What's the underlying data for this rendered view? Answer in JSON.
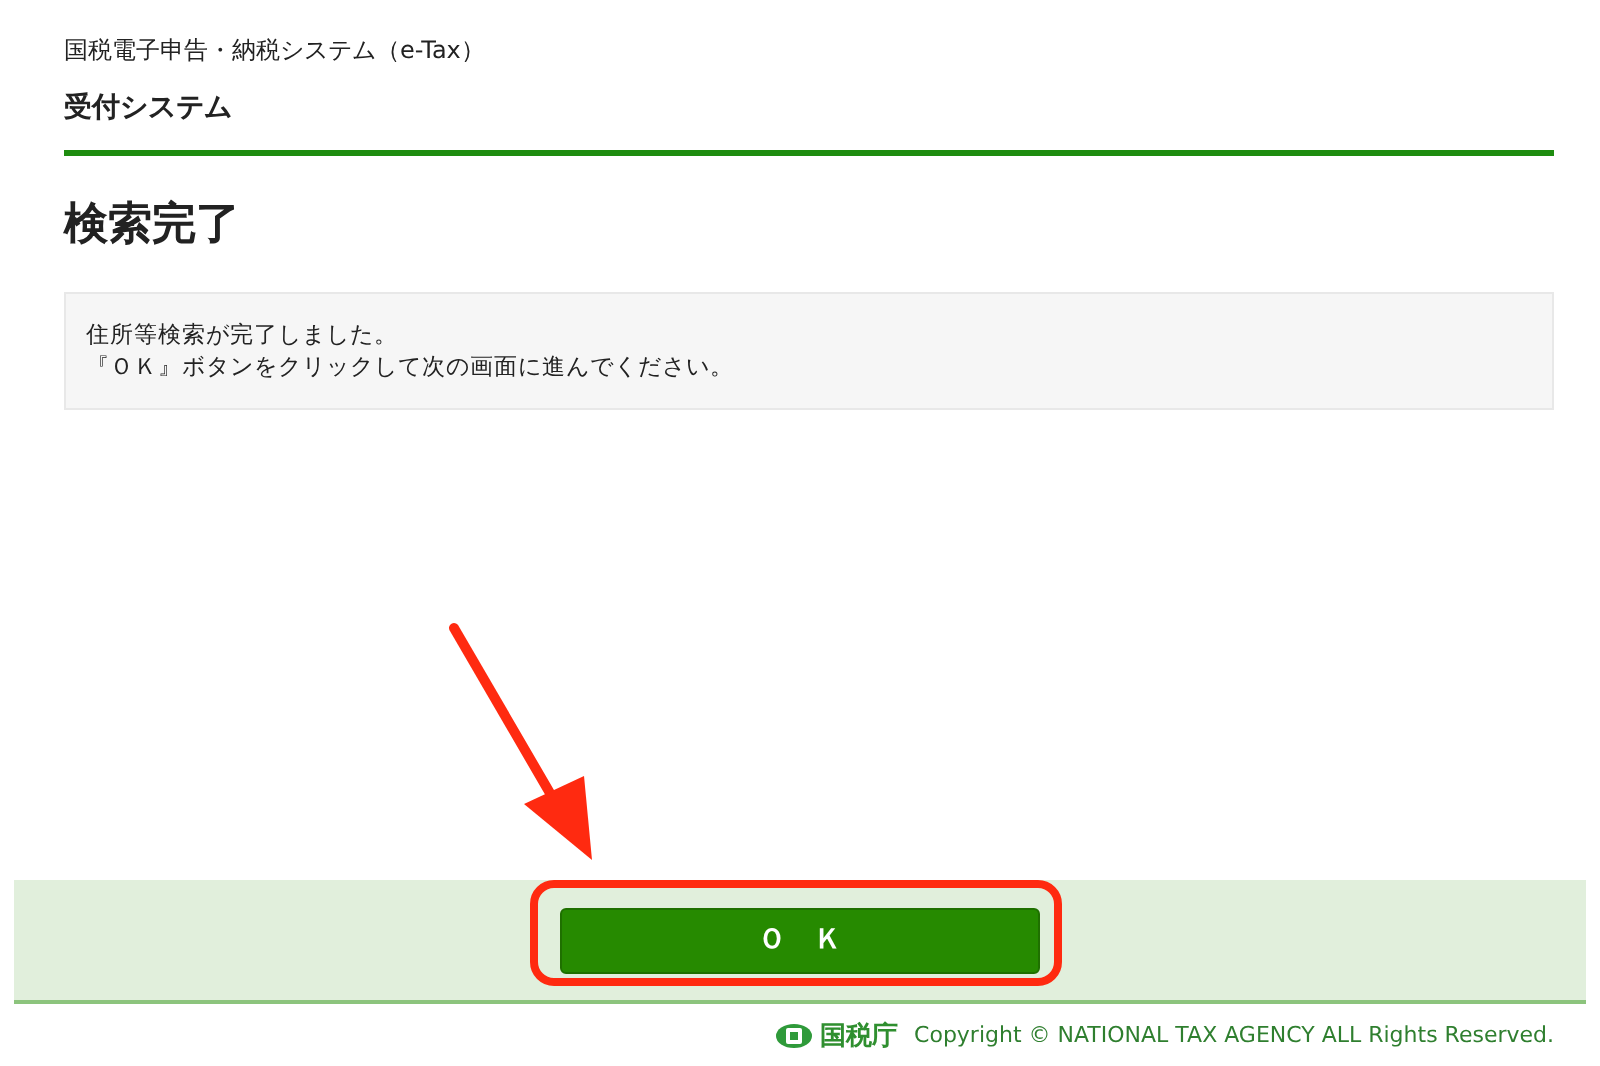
{
  "header": {
    "system_name": "国税電子申告・納税システム（e-Tax）",
    "subsystem": "受付システム"
  },
  "page_title": "検索完了",
  "message": {
    "lines": [
      "住所等検索が完了しました。",
      "『ＯＫ』ボタンをクリックして次の画面に進んでください。"
    ]
  },
  "action_bar": {
    "button": "Ｏ　Ｋ"
  },
  "footer": {
    "logo_text": "国税庁",
    "copyright": "Copyright © NATIONAL TAX AGENCY ALL Rights Reserved."
  }
}
